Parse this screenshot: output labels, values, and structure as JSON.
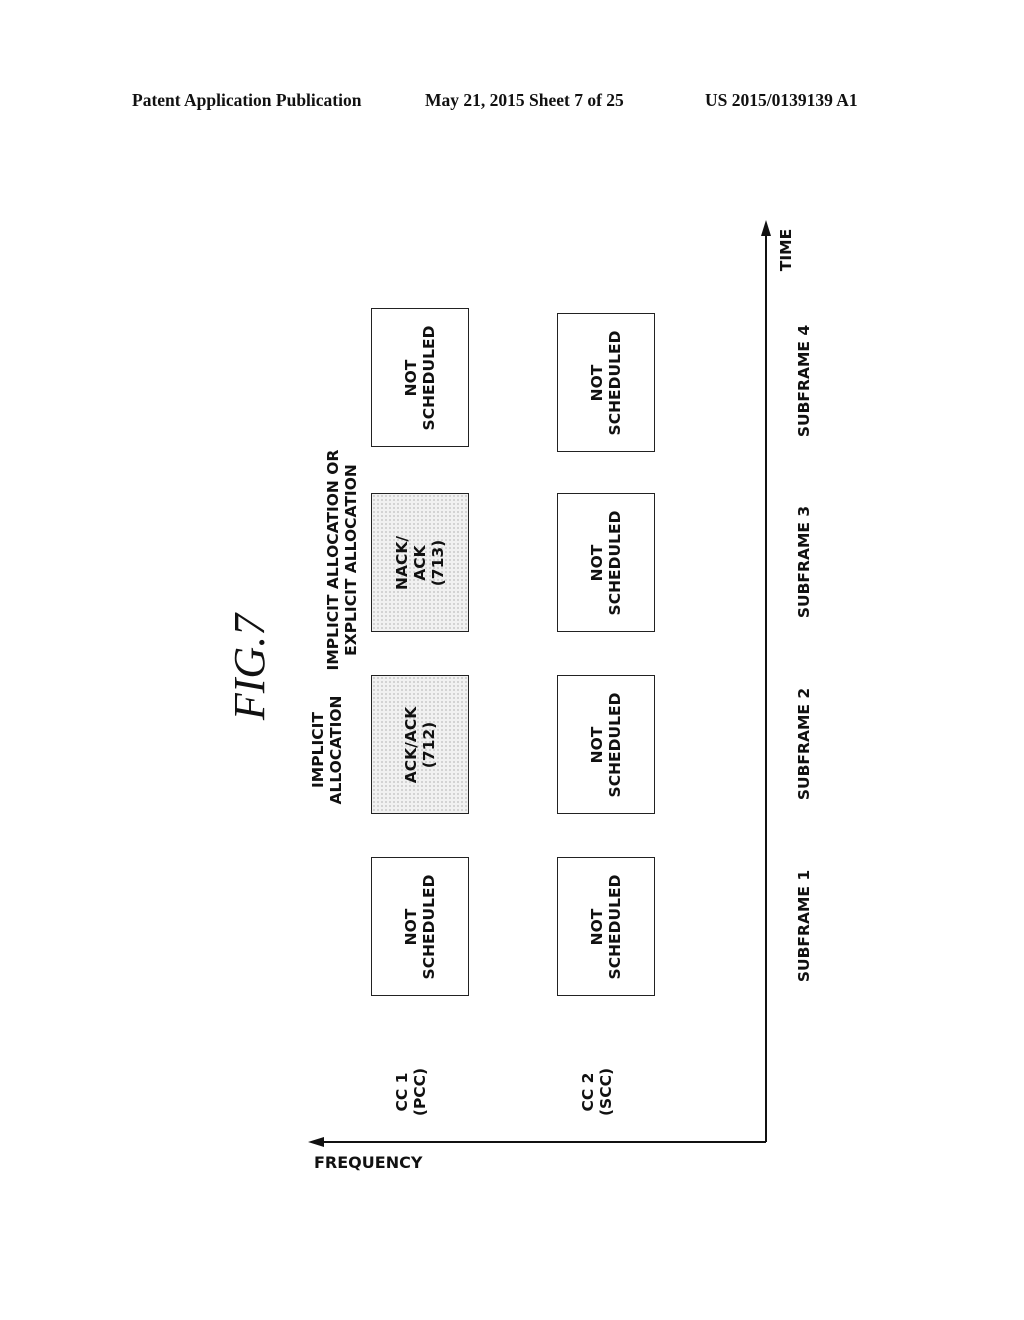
{
  "header": {
    "left": "Patent Application Publication",
    "middle": "May 21, 2015  Sheet 7 of 25",
    "right": "US 2015/0139139 A1"
  },
  "figure": {
    "title": "FIG.7",
    "axes": {
      "time_label": "TIME",
      "frequency_label": "FREQUENCY"
    },
    "carriers": [
      {
        "label": "CC  1\n(PCC)"
      },
      {
        "label": "CC  2\n(SCC)"
      }
    ],
    "subframes": [
      "SUBFRAME 1",
      "SUBFRAME 2",
      "SUBFRAME 3",
      "SUBFRAME 4"
    ],
    "annotations": {
      "subframe2": "IMPLICIT\nALLOCATION",
      "subframe3": "IMPLICIT ALLOCATION OR\nEXPLICIT ALLOCATION"
    },
    "cells": {
      "cc1": [
        {
          "text": "NOT\nSCHEDULED",
          "shaded": false
        },
        {
          "text": "ACK/ACK\n(712)",
          "shaded": true
        },
        {
          "text": "NACK/\nACK\n(713)",
          "shaded": true
        },
        {
          "text": "NOT\nSCHEDULED",
          "shaded": false
        }
      ],
      "cc2": [
        {
          "text": "NOT\nSCHEDULED",
          "shaded": false
        },
        {
          "text": "NOT\nSCHEDULED",
          "shaded": false
        },
        {
          "text": "NOT\nSCHEDULED",
          "shaded": false
        },
        {
          "text": "NOT\nSCHEDULED",
          "shaded": false
        }
      ]
    }
  }
}
